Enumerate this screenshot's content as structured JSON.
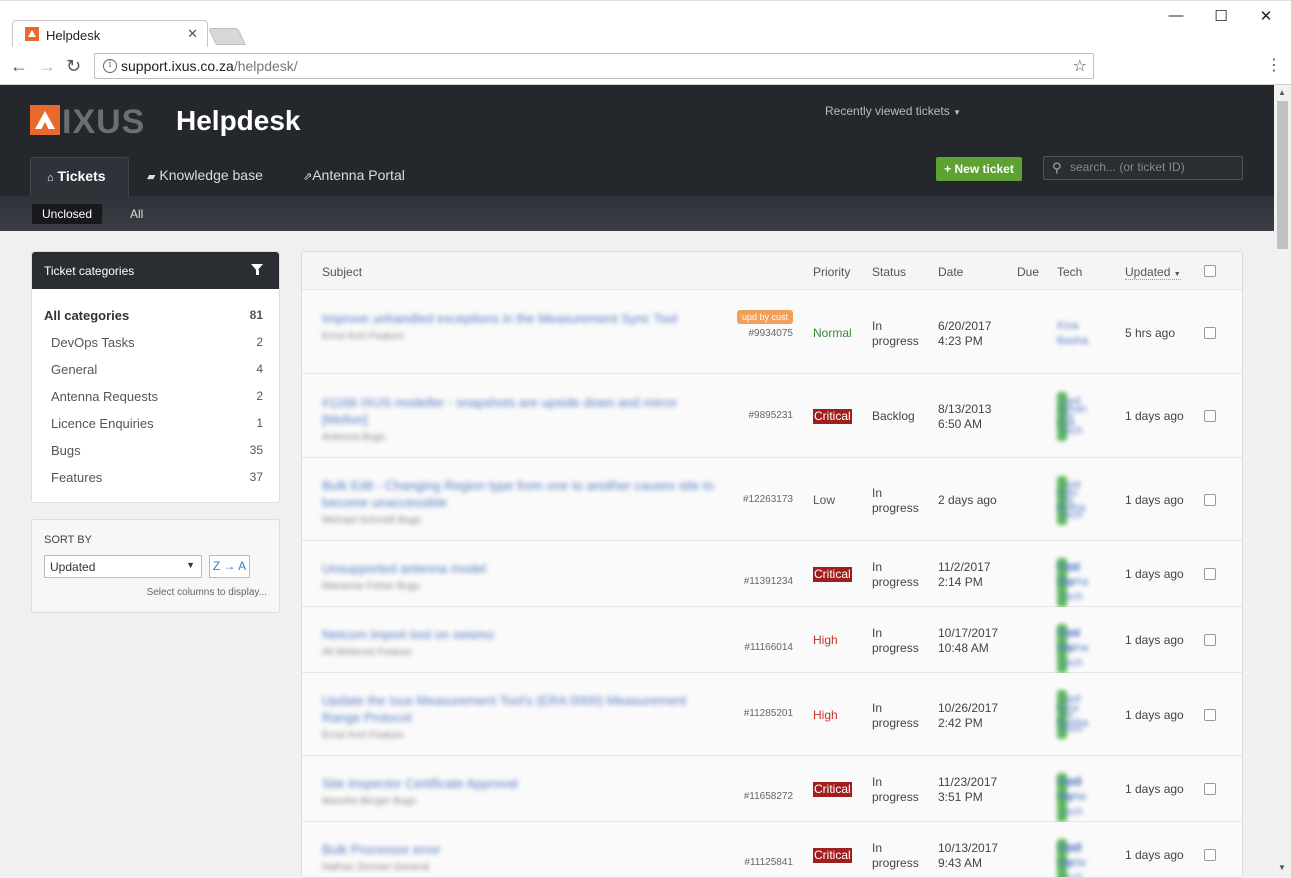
{
  "browser": {
    "tab_title": "Helpdesk",
    "url_host": "support.ixus.co.za",
    "url_path": "/helpdesk/"
  },
  "header": {
    "logo_text": "IXUS",
    "title": "Helpdesk",
    "recent": "Recently viewed tickets",
    "tabs": [
      {
        "label": "Tickets",
        "icon": "inbox-icon"
      },
      {
        "label": "Knowledge base",
        "icon": "book-icon"
      },
      {
        "label": "Antenna Portal",
        "icon": "external-link-icon"
      }
    ],
    "new_ticket": "+ New ticket",
    "search_placeholder": "search... (or ticket ID)",
    "subnav": [
      "Unclosed",
      "All"
    ]
  },
  "sidebar": {
    "title": "Ticket categories",
    "categories": [
      {
        "label": "All categories",
        "count": "81"
      },
      {
        "label": "DevOps Tasks",
        "count": "2"
      },
      {
        "label": "General",
        "count": "4"
      },
      {
        "label": "Antenna Requests",
        "count": "2"
      },
      {
        "label": "Licence Enquiries",
        "count": "1"
      },
      {
        "label": "Bugs",
        "count": "35"
      },
      {
        "label": "Features",
        "count": "37"
      }
    ],
    "sort_label": "SORT BY",
    "sort_value": "Updated",
    "sort_order": "Z → A",
    "select_columns": "Select columns to display..."
  },
  "table": {
    "columns": {
      "subject": "Subject",
      "priority": "Priority",
      "status": "Status",
      "date": "Date",
      "due": "Due",
      "tech": "Tech",
      "updated": "Updated"
    },
    "rows": [
      {
        "subject": "Improve unhandled exceptions in the Measurement Sync Tool",
        "meta": "Ernst Kort  Feature",
        "badge": "upd by cust",
        "badge_type": "cust",
        "id": "#9934075",
        "priority": "Normal",
        "priority_class": "normal",
        "status1": "In",
        "status2": "progress",
        "date1": "6/20/2017",
        "date2": "4:23 PM",
        "tech1": "Kiva",
        "tech2": "Basha",
        "updated": "5 hrs ago"
      },
      {
        "subject": "#1166 IXUS modeller - snapshots are upside down and mirror [Mellon]",
        "meta": "Antenna  Bugs",
        "badge": "upd by tech",
        "badge_type": "tech",
        "id": "#9895231",
        "priority": "Critical",
        "priority_class": "critical",
        "status1": "Backlog",
        "status2": "",
        "date1": "8/13/2013",
        "date2": "6:50 AM",
        "tech1": "Johan",
        "tech2": "Fell",
        "updated": "1 days ago"
      },
      {
        "subject": "Bulk Edit - Changing Region type from one to another causes site to become unaccessible",
        "meta": "Michael Schmidt  Bugs",
        "badge": "upd by tech",
        "badge_type": "tech",
        "id": "#12263173",
        "priority": "Low",
        "priority_class": "low",
        "status1": "In",
        "status2": "progress",
        "date1": "2 days ago",
        "date2": "",
        "tech1": "Ivan",
        "tech2": "Botha",
        "updated": "1 days ago"
      },
      {
        "subject": "Unsupported antenna model",
        "meta": "Marianne Fisher  Bugs",
        "badge": "upd by tech",
        "badge_type": "tech",
        "id": "#11391234",
        "priority": "Critical",
        "priority_class": "critical",
        "status1": "In",
        "status2": "progress",
        "date1": "11/2/2017",
        "date2": "2:14 PM",
        "tech1": "Kiva",
        "tech2": "Basha",
        "updated": "1 days ago"
      },
      {
        "subject": "Netcom import tool on seismo",
        "meta": "Ali Wisbrost  Feature",
        "badge": "upd by tech",
        "badge_type": "tech",
        "id": "#11166014",
        "priority": "High",
        "priority_class": "high",
        "status1": "In",
        "status2": "progress",
        "date1": "10/17/2017",
        "date2": "10:48 AM",
        "tech1": "Kiva",
        "tech2": "Basha",
        "updated": "1 days ago"
      },
      {
        "subject": "Update the Ixus Measurement Tool's (ERA 0000) Measurement Range Protocol",
        "meta": "Ernst Kort  Feature",
        "badge": "upd by tech",
        "badge_type": "tech",
        "id": "#11285201",
        "priority": "High",
        "priority_class": "high",
        "status1": "In",
        "status2": "progress",
        "date1": "10/26/2017",
        "date2": "2:42 PM",
        "tech1": "Kiva",
        "tech2": "Basha",
        "updated": "1 days ago"
      },
      {
        "subject": "Site Inspector Certificate Approval",
        "meta": "Moeshe Berger  Bugs",
        "badge": "upd by tech",
        "badge_type": "tech",
        "id": "#11658272",
        "priority": "Critical",
        "priority_class": "critical",
        "status1": "In",
        "status2": "progress",
        "date1": "11/23/2017",
        "date2": "3:51 PM",
        "tech1": "Heidi",
        "tech2": "Hertie",
        "updated": "1 days ago"
      },
      {
        "subject": "Bulk Processor error",
        "meta": "Nathan Zimmer  General",
        "badge": "upd by tech",
        "badge_type": "tech",
        "id": "#11125841",
        "priority": "Critical",
        "priority_class": "critical",
        "status1": "In",
        "status2": "progress",
        "date1": "10/13/2017",
        "date2": "9:43 AM",
        "tech1": "Heidi",
        "tech2": "Hertie",
        "updated": "1 days ago"
      }
    ]
  }
}
